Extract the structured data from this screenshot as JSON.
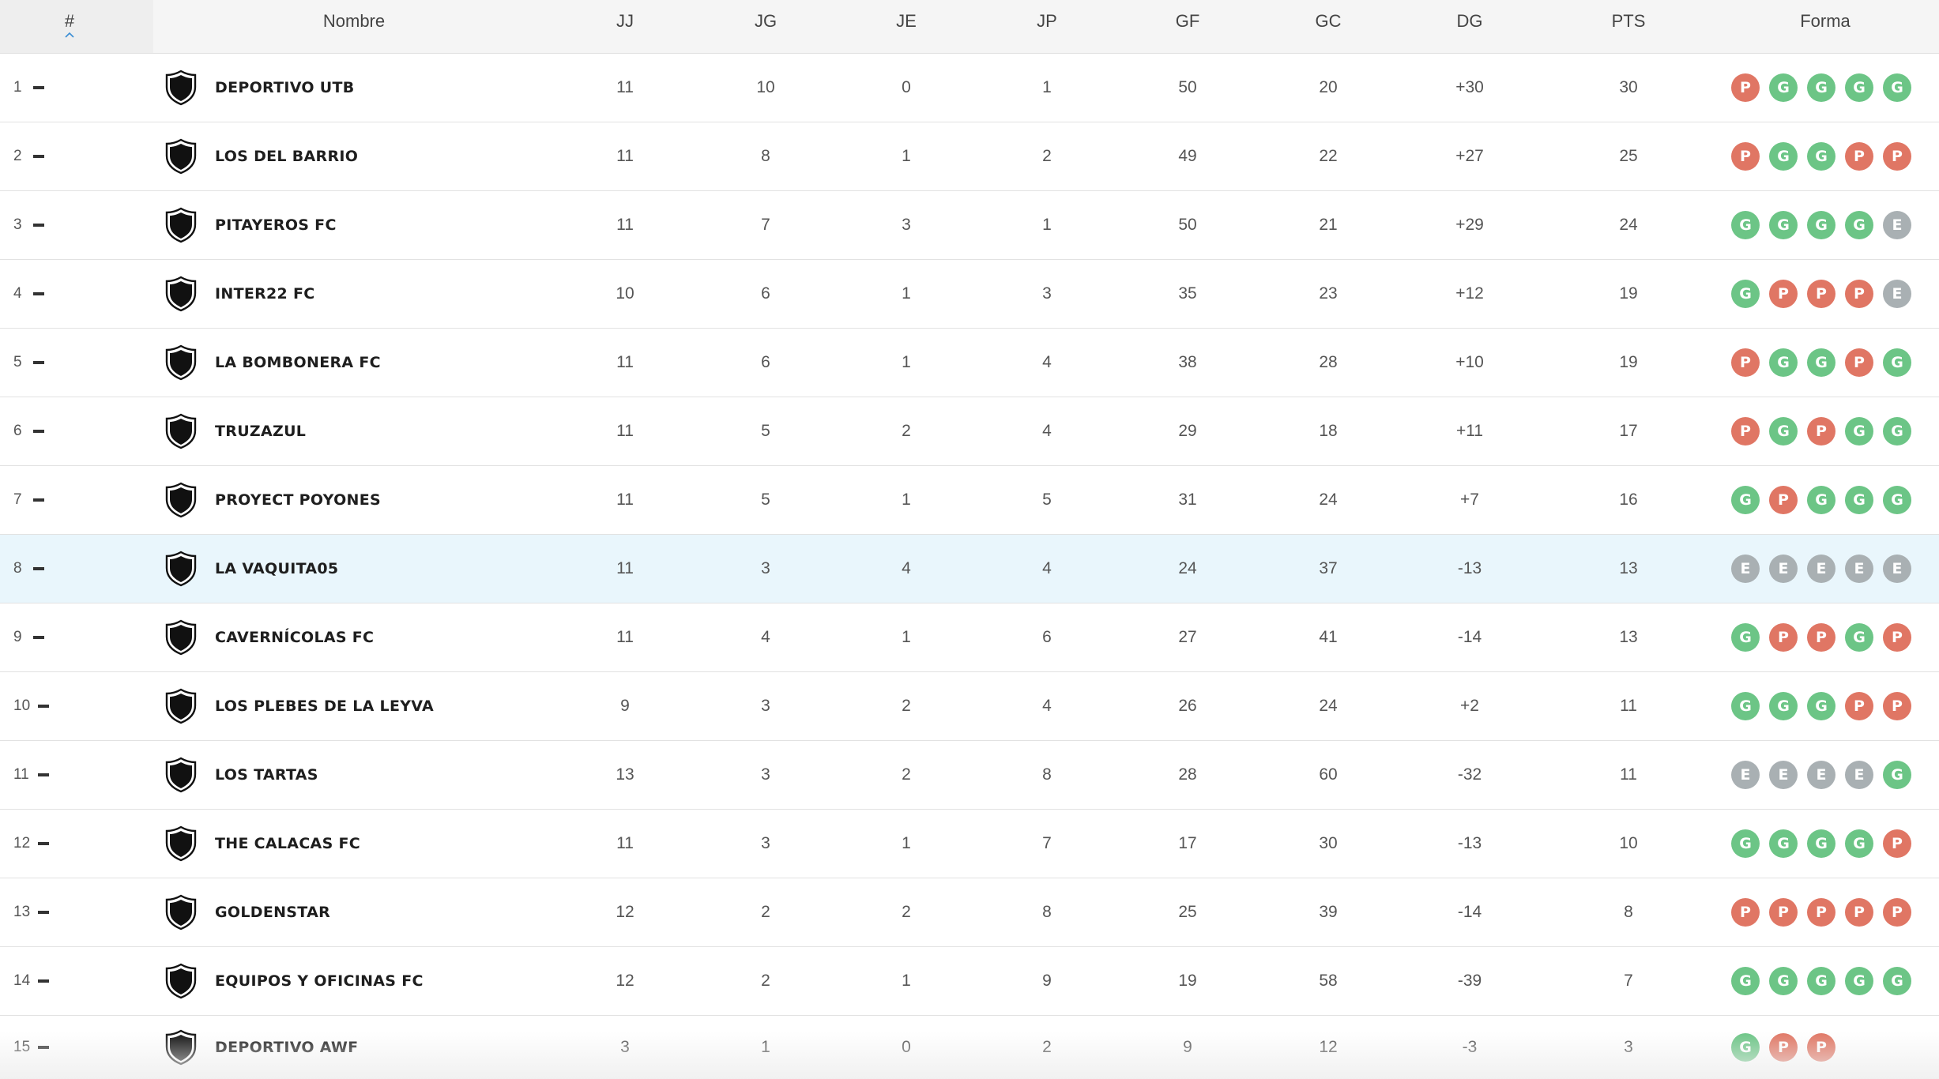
{
  "header": {
    "rank": "#",
    "name": "Nombre",
    "jj": "JJ",
    "jg": "JG",
    "je": "JE",
    "jp": "JP",
    "gf": "GF",
    "gc": "GC",
    "dg": "DG",
    "pts": "PTS",
    "forma": "Forma",
    "sort_icon": "chevron-up-icon",
    "trend_icon": "dash-icon",
    "crest_icon": "shield-icon"
  },
  "colors": {
    "win": "#6cc586",
    "loss": "#e07664",
    "draw": "#a9b0b3",
    "highlight_row": "#e9f6fc",
    "sort_accent": "#3b8ed4"
  },
  "rows": [
    {
      "rank": "1",
      "name": "DEPORTIVO UTB",
      "jj": "11",
      "jg": "10",
      "je": "0",
      "jp": "1",
      "gf": "50",
      "gc": "20",
      "dg": "+30",
      "pts": "30",
      "form": [
        "P",
        "G",
        "G",
        "G",
        "G"
      ]
    },
    {
      "rank": "2",
      "name": "LOS DEL BARRIO",
      "jj": "11",
      "jg": "8",
      "je": "1",
      "jp": "2",
      "gf": "49",
      "gc": "22",
      "dg": "+27",
      "pts": "25",
      "form": [
        "P",
        "G",
        "G",
        "P",
        "P"
      ]
    },
    {
      "rank": "3",
      "name": "PITAYEROS FC",
      "jj": "11",
      "jg": "7",
      "je": "3",
      "jp": "1",
      "gf": "50",
      "gc": "21",
      "dg": "+29",
      "pts": "24",
      "form": [
        "G",
        "G",
        "G",
        "G",
        "E"
      ]
    },
    {
      "rank": "4",
      "name": "INTER22 FC",
      "jj": "10",
      "jg": "6",
      "je": "1",
      "jp": "3",
      "gf": "35",
      "gc": "23",
      "dg": "+12",
      "pts": "19",
      "form": [
        "G",
        "P",
        "P",
        "P",
        "E"
      ]
    },
    {
      "rank": "5",
      "name": "LA BOMBONERA FC",
      "jj": "11",
      "jg": "6",
      "je": "1",
      "jp": "4",
      "gf": "38",
      "gc": "28",
      "dg": "+10",
      "pts": "19",
      "form": [
        "P",
        "G",
        "G",
        "P",
        "G"
      ]
    },
    {
      "rank": "6",
      "name": "TRUZAZUL",
      "jj": "11",
      "jg": "5",
      "je": "2",
      "jp": "4",
      "gf": "29",
      "gc": "18",
      "dg": "+11",
      "pts": "17",
      "form": [
        "P",
        "G",
        "P",
        "G",
        "G"
      ]
    },
    {
      "rank": "7",
      "name": "PROYECT POYONES",
      "jj": "11",
      "jg": "5",
      "je": "1",
      "jp": "5",
      "gf": "31",
      "gc": "24",
      "dg": "+7",
      "pts": "16",
      "form": [
        "G",
        "P",
        "G",
        "G",
        "G"
      ]
    },
    {
      "rank": "8",
      "name": "LA VAQUITA05",
      "jj": "11",
      "jg": "3",
      "je": "4",
      "jp": "4",
      "gf": "24",
      "gc": "37",
      "dg": "-13",
      "pts": "13",
      "form": [
        "E",
        "E",
        "E",
        "E",
        "E"
      ],
      "highlight": true
    },
    {
      "rank": "9",
      "name": "CAVERNÍCOLAS FC",
      "jj": "11",
      "jg": "4",
      "je": "1",
      "jp": "6",
      "gf": "27",
      "gc": "41",
      "dg": "-14",
      "pts": "13",
      "form": [
        "G",
        "P",
        "P",
        "G",
        "P"
      ]
    },
    {
      "rank": "10",
      "name": "LOS PLEBES DE LA LEYVA",
      "jj": "9",
      "jg": "3",
      "je": "2",
      "jp": "4",
      "gf": "26",
      "gc": "24",
      "dg": "+2",
      "pts": "11",
      "form": [
        "G",
        "G",
        "G",
        "P",
        "P"
      ]
    },
    {
      "rank": "11",
      "name": "LOS TARTAS",
      "jj": "13",
      "jg": "3",
      "je": "2",
      "jp": "8",
      "gf": "28",
      "gc": "60",
      "dg": "-32",
      "pts": "11",
      "form": [
        "E",
        "E",
        "E",
        "E",
        "G"
      ]
    },
    {
      "rank": "12",
      "name": "THE CALACAS FC",
      "jj": "11",
      "jg": "3",
      "je": "1",
      "jp": "7",
      "gf": "17",
      "gc": "30",
      "dg": "-13",
      "pts": "10",
      "form": [
        "G",
        "G",
        "G",
        "G",
        "P"
      ]
    },
    {
      "rank": "13",
      "name": "GOLDENSTAR",
      "jj": "12",
      "jg": "2",
      "je": "2",
      "jp": "8",
      "gf": "25",
      "gc": "39",
      "dg": "-14",
      "pts": "8",
      "form": [
        "P",
        "P",
        "P",
        "P",
        "P"
      ]
    },
    {
      "rank": "14",
      "name": "EQUIPOS Y OFICINAS FC",
      "jj": "12",
      "jg": "2",
      "je": "1",
      "jp": "9",
      "gf": "19",
      "gc": "58",
      "dg": "-39",
      "pts": "7",
      "form": [
        "G",
        "G",
        "G",
        "G",
        "G"
      ]
    },
    {
      "rank": "15",
      "name": "DEPORTIVO AWF",
      "jj": "3",
      "jg": "1",
      "je": "0",
      "jp": "2",
      "gf": "9",
      "gc": "12",
      "dg": "-3",
      "pts": "3",
      "form": [
        "G",
        "P",
        "P"
      ]
    }
  ]
}
